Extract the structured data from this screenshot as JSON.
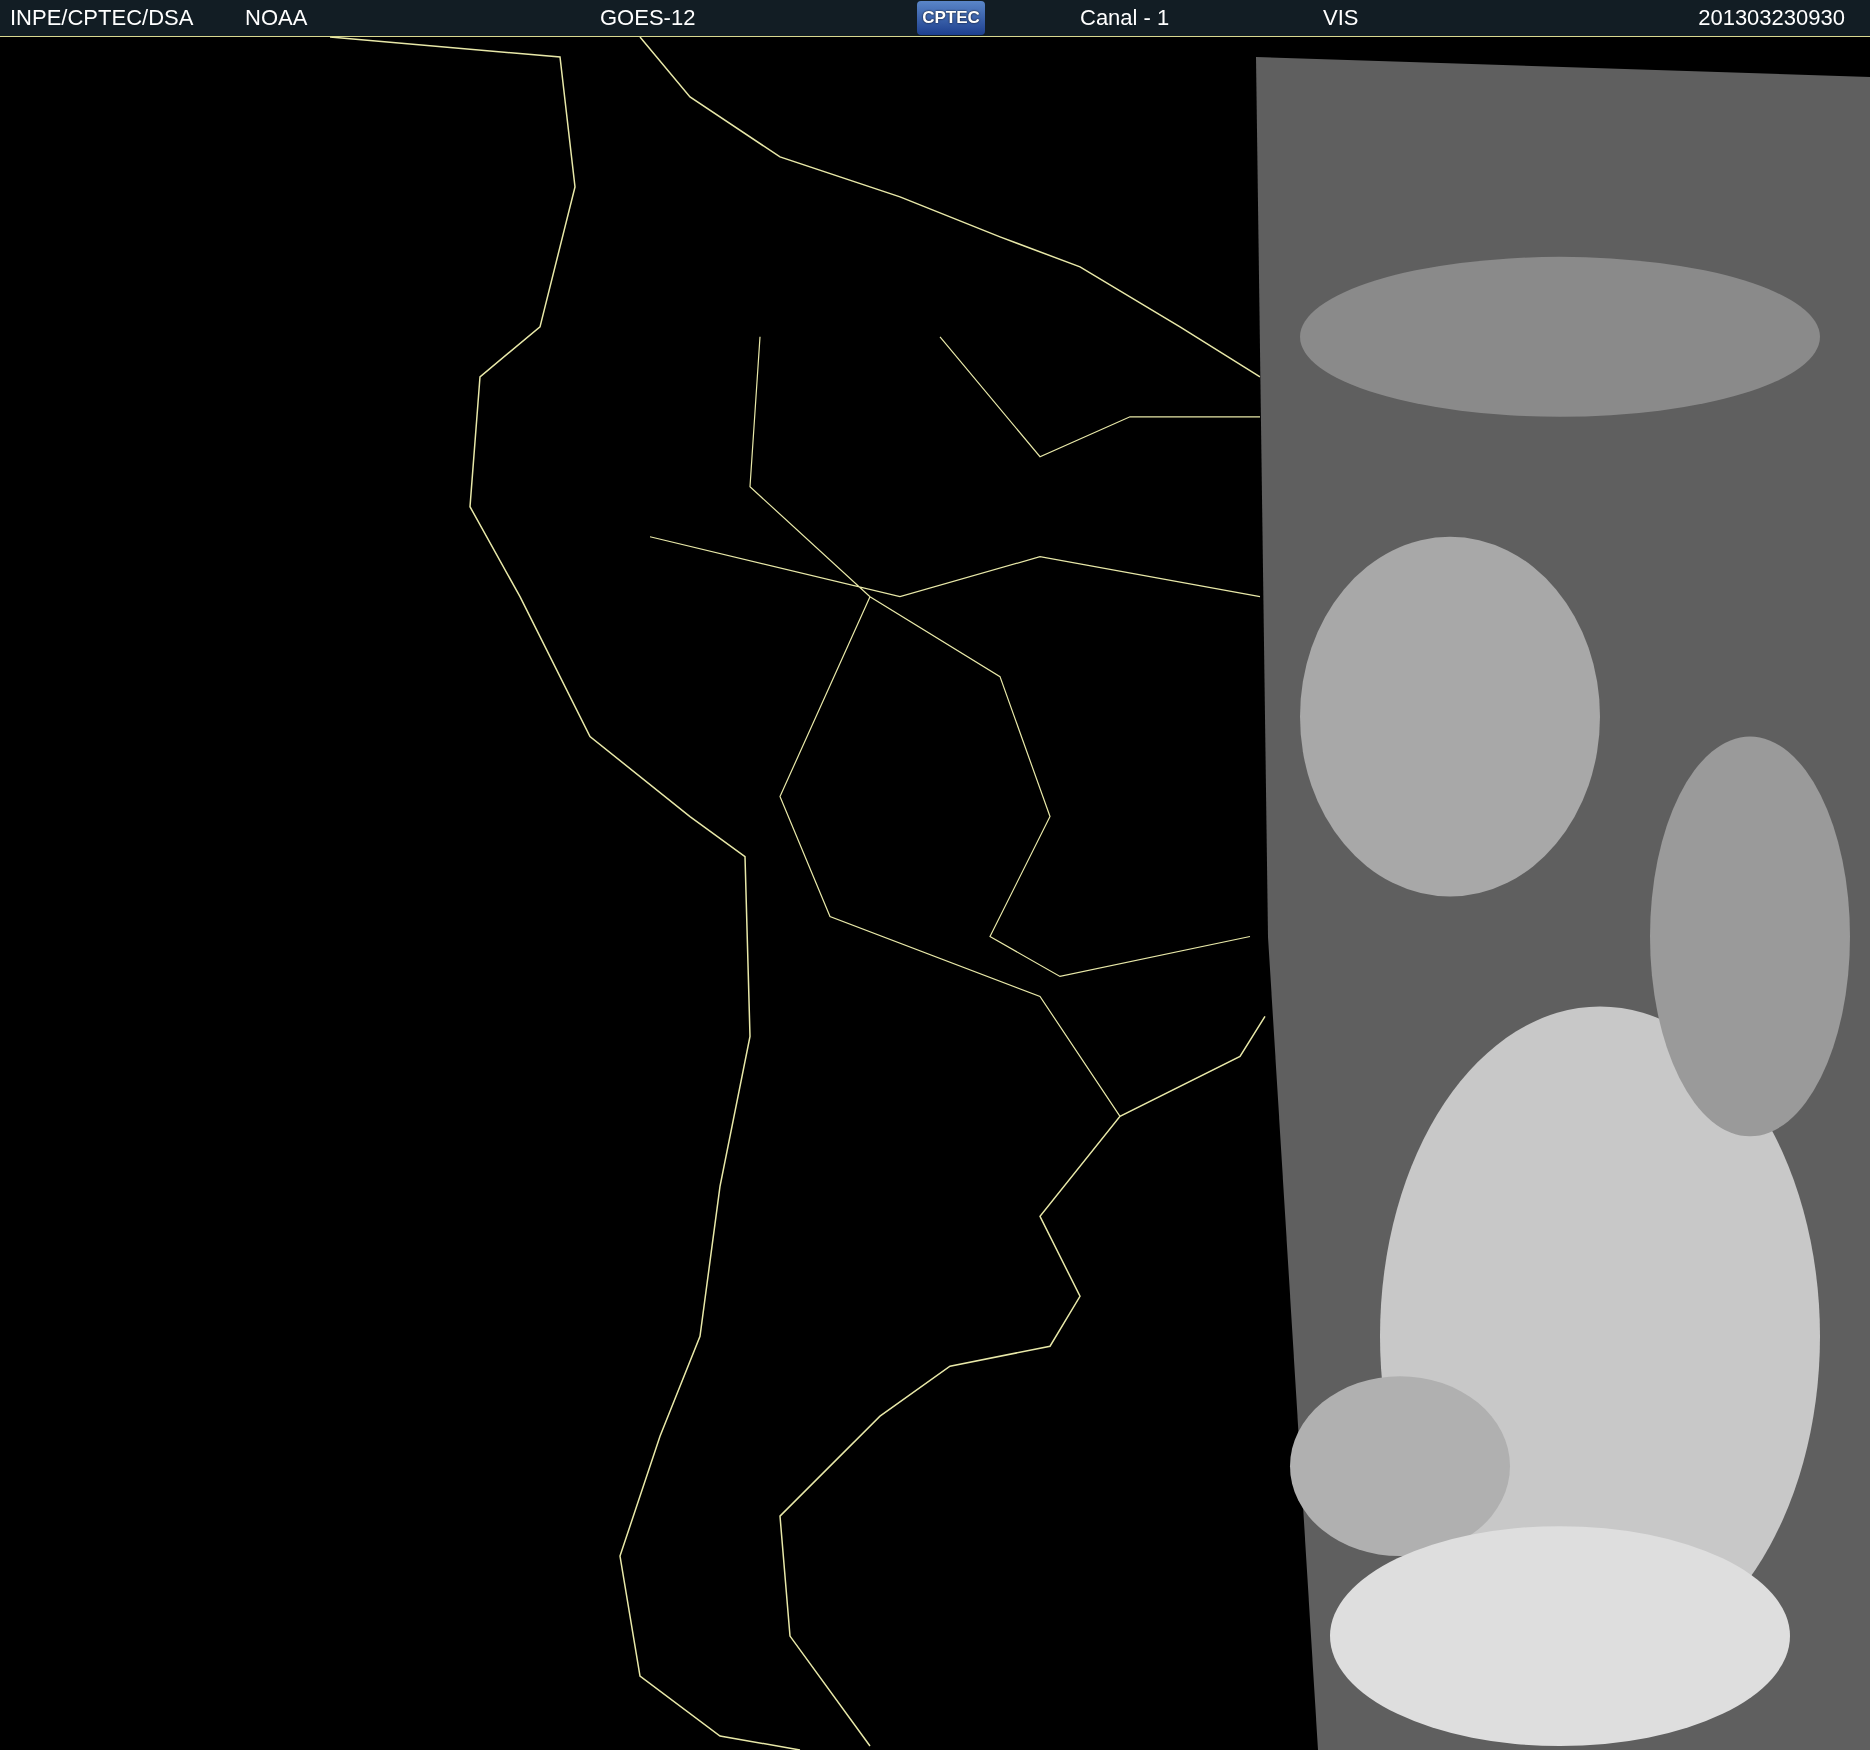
{
  "header": {
    "source": "INPE/CPTEC/DSA",
    "agency": "NOAA",
    "satellite": "GOES-12",
    "logo": "CPTEC",
    "channel": "Canal - 1",
    "band": "VIS",
    "timestamp": "201303230930"
  }
}
